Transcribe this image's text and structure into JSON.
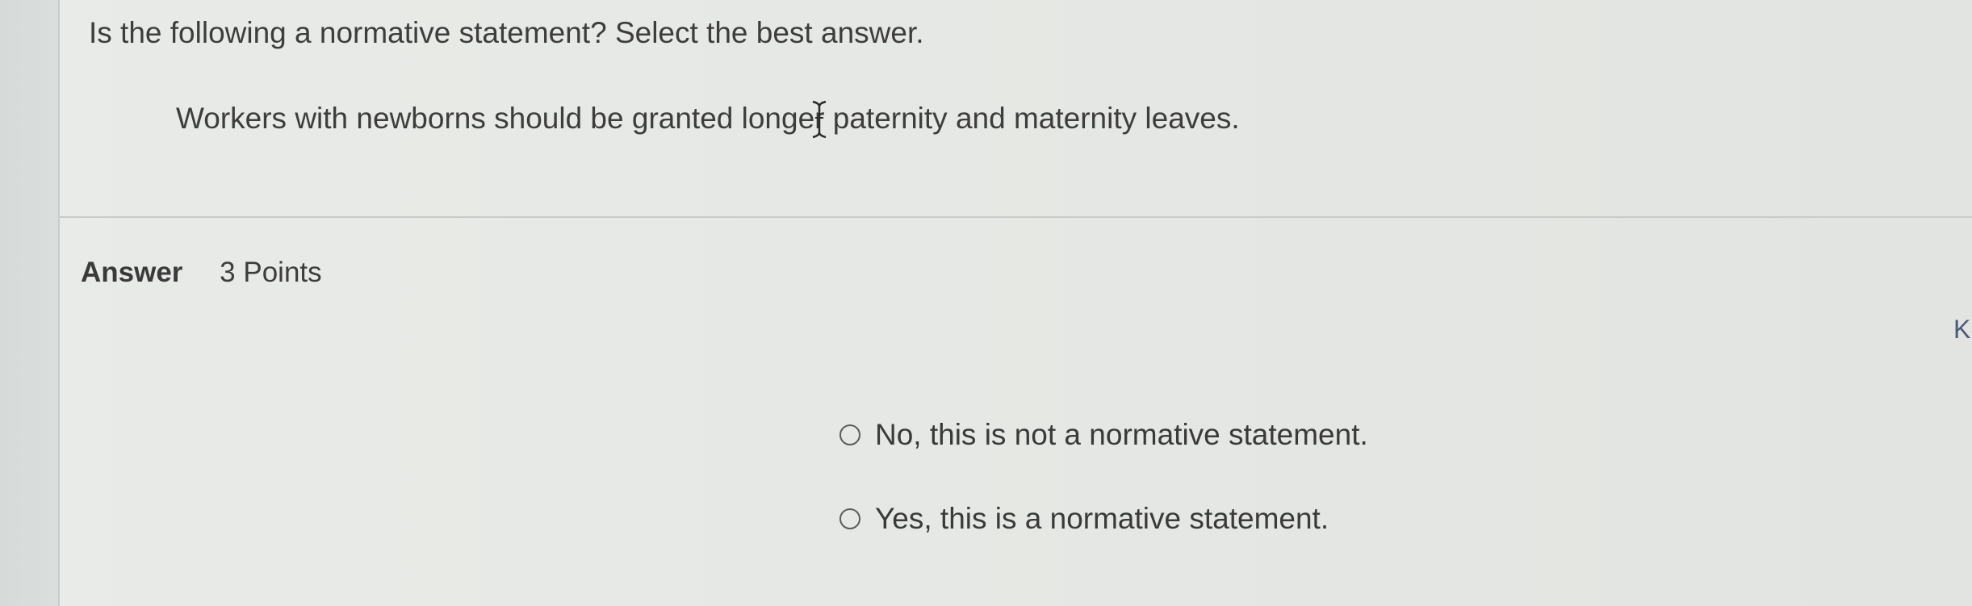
{
  "question": {
    "prompt": "Is the following a normative statement? Select the best answer.",
    "statement": "Workers with newborns should be granted longer paternity and maternity leaves."
  },
  "answer": {
    "label": "Answer",
    "points": "3 Points",
    "options": [
      {
        "label": "No, this is not a normative statement.",
        "selected": false
      },
      {
        "label": "Yes, this is a normative statement.",
        "selected": false
      }
    ]
  },
  "edge_letter": "K",
  "colors": {
    "background": "#e6e8e5",
    "gutter": "#d8dcda",
    "text": "#3a3a3a",
    "divider": "#c8cbc8"
  },
  "icons": {
    "cursor": "text-cursor-icon"
  }
}
